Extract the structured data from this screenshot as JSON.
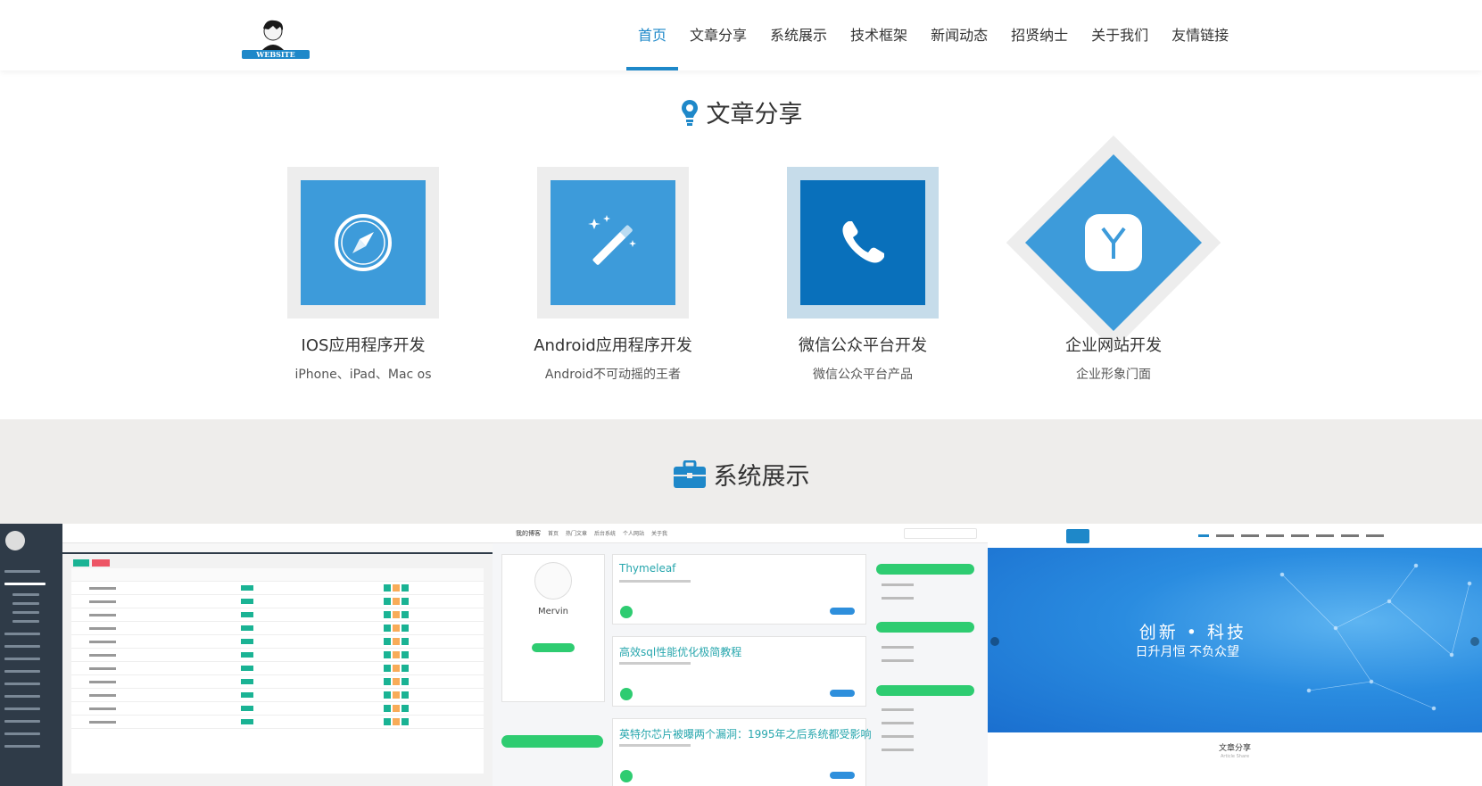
{
  "logo": {
    "text": "WEBSITE"
  },
  "nav": {
    "items": [
      {
        "label": "首页",
        "active": true
      },
      {
        "label": "文章分享",
        "active": false
      },
      {
        "label": "系统展示",
        "active": false
      },
      {
        "label": "技术框架",
        "active": false
      },
      {
        "label": "新闻动态",
        "active": false
      },
      {
        "label": "招贤纳士",
        "active": false
      },
      {
        "label": "关于我们",
        "active": false
      },
      {
        "label": "友情链接",
        "active": false
      }
    ],
    "accent_color": "#1e88c9"
  },
  "articles": {
    "title": "文章分享",
    "icon": "lightbulb-icon",
    "cards": [
      {
        "title": "IOS应用程序开发",
        "desc": "iPhone、iPad、Mac os",
        "icon": "compass-icon"
      },
      {
        "title": "Android应用程序开发",
        "desc": "Android不可动摇的王者",
        "icon": "magic-wand-icon"
      },
      {
        "title": "微信公众平台开发",
        "desc": "微信公众平台产品",
        "icon": "phone-icon"
      },
      {
        "title": "企业网站开发",
        "desc": "企业形象门面",
        "icon": "yen-icon"
      }
    ]
  },
  "systems": {
    "title": "系统展示",
    "icon": "briefcase-icon",
    "blog": {
      "brand": "我的博客",
      "links": [
        "首页",
        "热门文章",
        "后台系统",
        "个人网站",
        "关于我"
      ],
      "name": "Mervin",
      "posts": [
        "Thymeleaf",
        "高效sql性能优化极简教程",
        "英特尔芯片被曝两个漏洞：1995年之后系统都受影响"
      ]
    },
    "site": {
      "slogan": "创新 • 科技",
      "subslogan": "日升月恒  不负众望",
      "section": "文章分享",
      "section_en": "Article Share"
    }
  }
}
